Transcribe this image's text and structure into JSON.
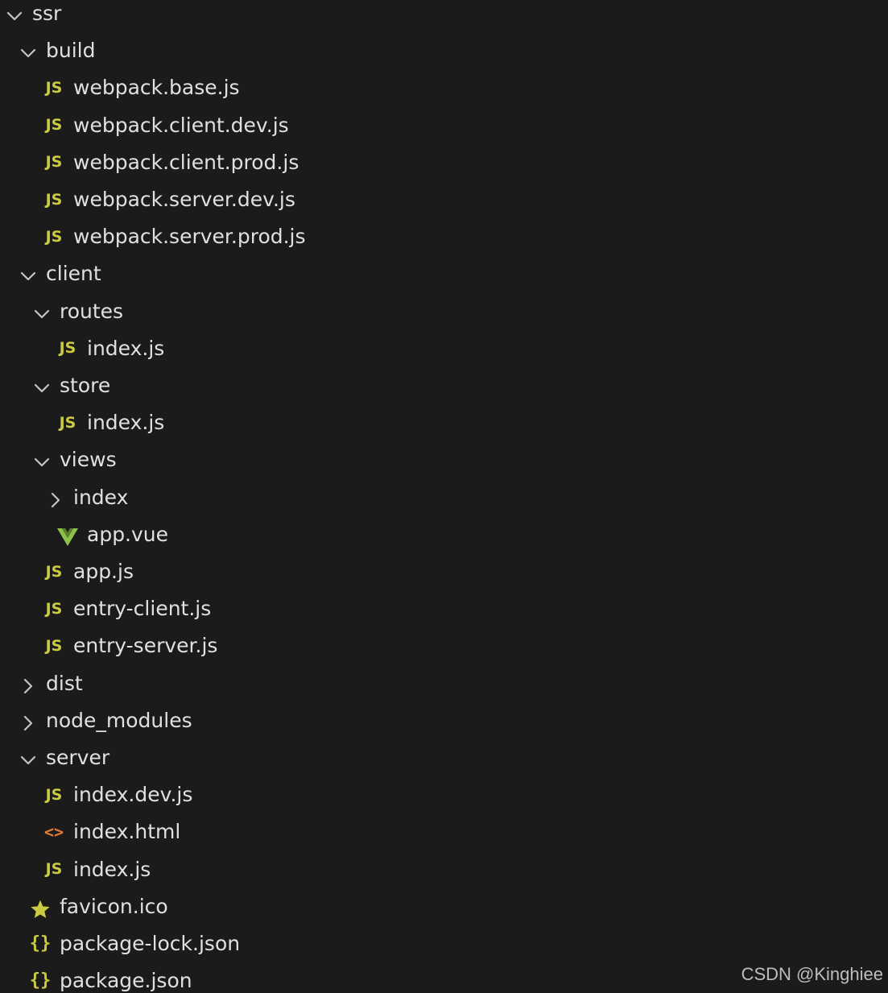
{
  "colors": {
    "background": "#1b1b1b",
    "text": "#e0e0e0",
    "chevron": "#c5c5c5",
    "js_icon": "#cbcb41",
    "vue_icon": "#8dc149",
    "html_icon": "#e37933",
    "favicon_icon": "#cbcb41",
    "json_icon": "#cbcb41",
    "watermark": "#bdbdbd"
  },
  "tree": [
    {
      "name": "ssr",
      "kind": "folder",
      "expanded": true,
      "depth": 0
    },
    {
      "name": "build",
      "kind": "folder",
      "expanded": true,
      "depth": 1
    },
    {
      "name": "webpack.base.js",
      "kind": "file",
      "icon": "js-icon",
      "depth": 2
    },
    {
      "name": "webpack.client.dev.js",
      "kind": "file",
      "icon": "js-icon",
      "depth": 2
    },
    {
      "name": "webpack.client.prod.js",
      "kind": "file",
      "icon": "js-icon",
      "depth": 2
    },
    {
      "name": "webpack.server.dev.js",
      "kind": "file",
      "icon": "js-icon",
      "depth": 2
    },
    {
      "name": "webpack.server.prod.js",
      "kind": "file",
      "icon": "js-icon",
      "depth": 2
    },
    {
      "name": "client",
      "kind": "folder",
      "expanded": true,
      "depth": 1
    },
    {
      "name": "routes",
      "kind": "folder",
      "expanded": true,
      "depth": 2
    },
    {
      "name": "index.js",
      "kind": "file",
      "icon": "js-icon",
      "depth": 3
    },
    {
      "name": "store",
      "kind": "folder",
      "expanded": true,
      "depth": 2
    },
    {
      "name": "index.js",
      "kind": "file",
      "icon": "js-icon",
      "depth": 3
    },
    {
      "name": "views",
      "kind": "folder",
      "expanded": true,
      "depth": 2
    },
    {
      "name": "index",
      "kind": "folder",
      "expanded": false,
      "depth": 3
    },
    {
      "name": "app.vue",
      "kind": "file",
      "icon": "vue-icon",
      "depth": 3
    },
    {
      "name": "app.js",
      "kind": "file",
      "icon": "js-icon",
      "depth": 2
    },
    {
      "name": "entry-client.js",
      "kind": "file",
      "icon": "js-icon",
      "depth": 2
    },
    {
      "name": "entry-server.js",
      "kind": "file",
      "icon": "js-icon",
      "depth": 2
    },
    {
      "name": "dist",
      "kind": "folder",
      "expanded": false,
      "depth": 1
    },
    {
      "name": "node_modules",
      "kind": "folder",
      "expanded": false,
      "depth": 1
    },
    {
      "name": "server",
      "kind": "folder",
      "expanded": true,
      "depth": 1
    },
    {
      "name": "index.dev.js",
      "kind": "file",
      "icon": "js-icon",
      "depth": 2
    },
    {
      "name": "index.html",
      "kind": "file",
      "icon": "html-icon",
      "depth": 2
    },
    {
      "name": "index.js",
      "kind": "file",
      "icon": "js-icon",
      "depth": 2
    },
    {
      "name": "favicon.ico",
      "kind": "file",
      "icon": "star-icon",
      "depth": 1
    },
    {
      "name": "package-lock.json",
      "kind": "file",
      "icon": "json-icon",
      "depth": 1
    },
    {
      "name": "package.json",
      "kind": "file",
      "icon": "json-icon",
      "depth": 1
    }
  ],
  "icon_glyphs": {
    "js-icon": "JS",
    "json-icon": "{}",
    "html-icon": "<>"
  },
  "watermark": "CSDN @Kinghiee"
}
